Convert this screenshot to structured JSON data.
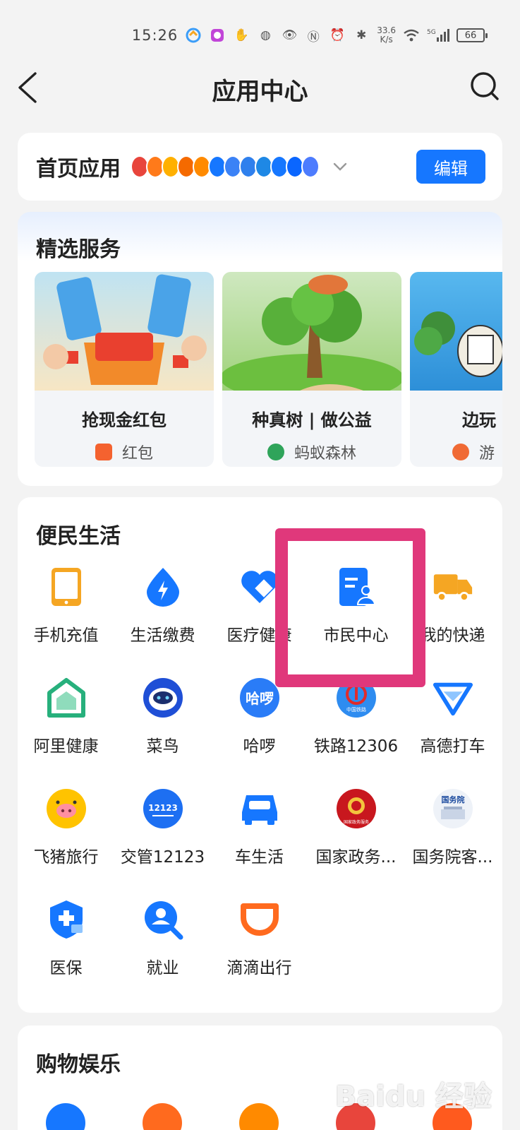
{
  "status_bar": {
    "time": "15:26",
    "net_speed_value": "33.6",
    "net_speed_unit": "K/s",
    "battery": "66",
    "signal_label": "5G"
  },
  "header": {
    "title": "应用中心",
    "back_icon": "chevron-left-icon",
    "search_icon": "search-icon"
  },
  "home_apps": {
    "label": "首页应用",
    "edit_label": "编辑",
    "strip_colors": [
      "#e8453c",
      "#ff7a1a",
      "#ffb000",
      "#f56a00",
      "#ff8a00",
      "#1677ff",
      "#3b82f6",
      "#2f80ed",
      "#1e88e5",
      "#1677ff",
      "#0a66ff",
      "#4d7cfe"
    ]
  },
  "featured": {
    "title": "精选服务",
    "cards": [
      {
        "title": "抢现金红包",
        "sub": "红包",
        "sub_color": "#f4622f"
      },
      {
        "title": "种真树 | 做公益",
        "sub": "蚂蚁森林",
        "sub_color": "#2fa45a"
      },
      {
        "title": "边玩",
        "sub": "游",
        "sub_color": "#f06a35"
      }
    ]
  },
  "life": {
    "title": "便民生活",
    "items": [
      {
        "label": "手机充值",
        "icon": "phone-icon",
        "color": "#f5a623"
      },
      {
        "label": "生活缴费",
        "icon": "lightning-icon",
        "color": "#1677ff"
      },
      {
        "label": "医疗健康",
        "icon": "heart-icon",
        "color": "#1677ff"
      },
      {
        "label": "市民中心",
        "icon": "citizen-doc-icon",
        "color": "#1677ff"
      },
      {
        "label": "我的快递",
        "icon": "truck-icon",
        "color": "#f5a623"
      },
      {
        "label": "阿里健康",
        "icon": "ali-health-icon",
        "color": "#27b07c"
      },
      {
        "label": "菜鸟",
        "icon": "cainiao-icon",
        "color": "#1677ff"
      },
      {
        "label": "哈啰",
        "icon": "hellobike-icon",
        "color": "#1677ff"
      },
      {
        "label": "铁路12306",
        "icon": "railway-icon",
        "color": "#1677ff"
      },
      {
        "label": "高德打车",
        "icon": "amap-icon",
        "color": "#1677ff"
      },
      {
        "label": "飞猪旅行",
        "icon": "fliggy-icon",
        "color": "#ffc300"
      },
      {
        "label": "交管12123",
        "icon": "traffic-12123-icon",
        "color": "#1677ff"
      },
      {
        "label": "车生活",
        "icon": "car-icon",
        "color": "#1677ff"
      },
      {
        "label": "国家政务...",
        "icon": "gov-service-icon",
        "color": "#d9251c"
      },
      {
        "label": "国务院客...",
        "icon": "state-council-icon",
        "color": "#2a5ba8"
      },
      {
        "label": "医保",
        "icon": "medical-insurance-icon",
        "color": "#1677ff"
      },
      {
        "label": "就业",
        "icon": "job-search-icon",
        "color": "#1677ff"
      },
      {
        "label": "滴滴出行",
        "icon": "didi-icon",
        "color": "#ff6a1e"
      }
    ],
    "feature_labels": {
      "hellobike": "哈啰",
      "cainiao_mark": "12123",
      "railway_mark": "中国铁路",
      "gov_mark": "国家政务服务",
      "state_council_mark": "国务院"
    }
  },
  "shopping": {
    "title": "购物娱乐"
  },
  "watermark": "Baidu 经验"
}
